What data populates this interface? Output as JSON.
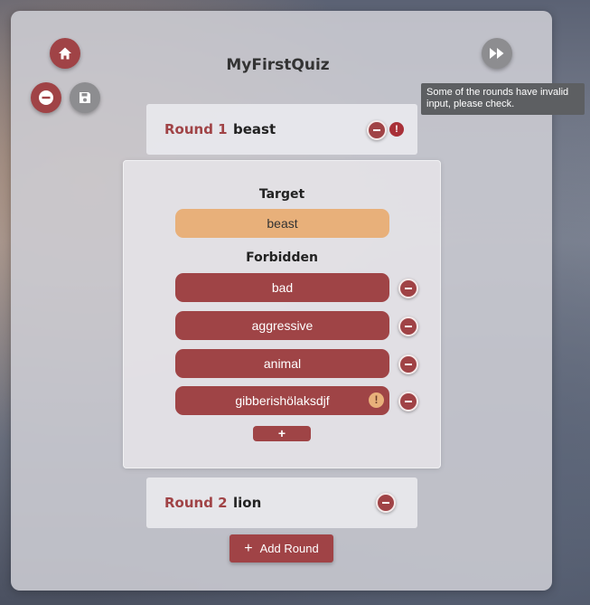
{
  "app": {
    "title": "MyFirstQuiz"
  },
  "tooltip": {
    "text": "Some of the rounds have invalid input, please check."
  },
  "rounds": [
    {
      "label": "Round 1",
      "word": "beast",
      "warning": "!"
    },
    {
      "label": "Round 2",
      "word": "lion"
    }
  ],
  "editor": {
    "target_label": "Target",
    "target_value": "beast",
    "forbidden_label": "Forbidden",
    "forbidden": [
      "bad",
      "aggressive",
      "animal",
      "gibberishölaksdjf"
    ],
    "forbidden_warning": "!",
    "add_forbidden_label": "+"
  },
  "add_round": {
    "icon": "+",
    "label": "Add Round"
  },
  "icons": {
    "home": "home-icon",
    "remove": "minus-circle-icon",
    "save": "floppy-disk-icon",
    "forward": "fast-forward-icon"
  },
  "colors": {
    "accent": "#a04346",
    "target": "#e8b07a",
    "panel": "#cdcdd4"
  }
}
